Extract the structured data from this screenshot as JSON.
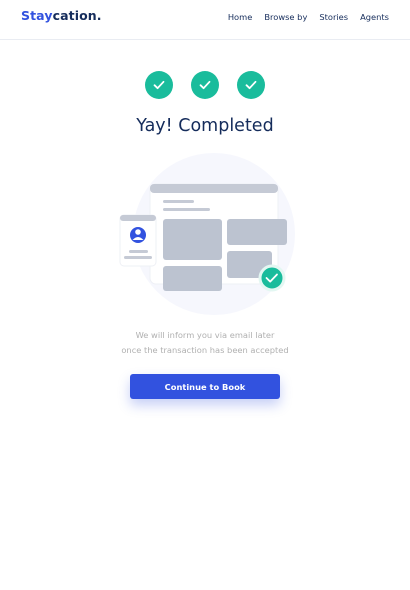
{
  "navbar": {
    "brand_accent": "Stay",
    "brand_rest": "cation.",
    "links": [
      "Home",
      "Browse by",
      "Stories",
      "Agents"
    ]
  },
  "steps": {
    "count": 3,
    "status": "completed",
    "color": "#1abc9c"
  },
  "page": {
    "title": "Yay! Completed",
    "message_line1": "We will inform you via email later",
    "message_line2": "once the transaction has been accepted"
  },
  "actions": {
    "continue_label": "Continue to Book",
    "color": "#3252df"
  },
  "illustration": {
    "icons": [
      "user-avatar-icon",
      "check-badge-icon"
    ]
  }
}
